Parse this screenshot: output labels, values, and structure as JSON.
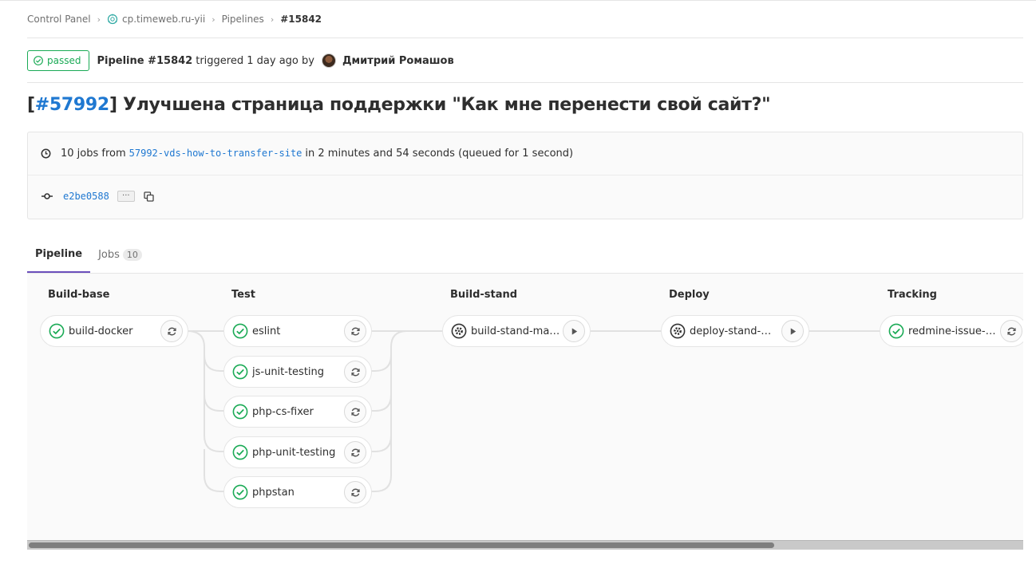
{
  "breadcrumb": {
    "control_panel": "Control Panel",
    "project": "cp.timeweb.ru-yii",
    "pipelines": "Pipelines",
    "current": "#15842"
  },
  "header": {
    "status": "passed",
    "pipeline_name": "Pipeline #15842",
    "triggered_text": "triggered",
    "time_ago": "1 day ago",
    "by_text": "by",
    "author": "Дмитрий Ромашов"
  },
  "title": {
    "bracket_open": "[",
    "issue_link": "#57992",
    "text": "] Улучшена страница поддержки \"Как мне перенести свой сайт?\""
  },
  "info": {
    "jobs_text": "10 jobs from",
    "branch": "57992-vds-how-to-transfer-site",
    "duration_text": "in 2 minutes and 54 seconds (queued for 1 second)",
    "commit_sha": "e2be0588",
    "ellipsis": "···"
  },
  "tabs": [
    {
      "label": "Pipeline"
    },
    {
      "label": "Jobs",
      "count": "10"
    }
  ],
  "stages": [
    {
      "name": "Build-base",
      "jobs": [
        {
          "label": "build-docker",
          "status": "success",
          "action": "retry"
        }
      ]
    },
    {
      "name": "Test",
      "jobs": [
        {
          "label": "eslint",
          "status": "success",
          "action": "retry"
        },
        {
          "label": "js-unit-testing",
          "status": "success",
          "action": "retry"
        },
        {
          "label": "php-cs-fixer",
          "status": "success",
          "action": "retry"
        },
        {
          "label": "php-unit-testing",
          "status": "success",
          "action": "retry"
        },
        {
          "label": "phpstan",
          "status": "success",
          "action": "retry"
        }
      ]
    },
    {
      "name": "Build-stand",
      "jobs": [
        {
          "label": "build-stand-ma…",
          "status": "manual",
          "action": "play"
        }
      ]
    },
    {
      "name": "Deploy",
      "jobs": [
        {
          "label": "deploy-stand-m…",
          "status": "manual",
          "action": "play"
        }
      ]
    },
    {
      "name": "Tracking",
      "jobs": [
        {
          "label": "redmine-issue-t…",
          "status": "success",
          "action": "retry"
        }
      ]
    }
  ],
  "colors": {
    "success": "#1aaa55",
    "link": "#1f78d1",
    "active_tab": "#6b4fbb"
  },
  "icons": {
    "success": "check-circle-icon",
    "manual": "gear-icon",
    "retry": "retry-icon",
    "play": "play-icon",
    "clock": "clock-icon",
    "commit": "commit-icon",
    "copy": "copy-icon"
  }
}
